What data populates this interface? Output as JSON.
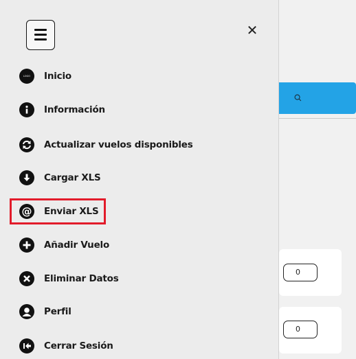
{
  "drawer": {
    "close_symbol": "✕",
    "menu_icon": "hamburger-menu-icon",
    "items": [
      {
        "label": "Inicio",
        "icon": "logo-icon",
        "icon_text": "LOGO"
      },
      {
        "label": "Información",
        "icon": "info-icon"
      },
      {
        "label": "Actualizar vuelos disponibles",
        "icon": "refresh-icon"
      },
      {
        "label": "Cargar XLS",
        "icon": "download-icon"
      },
      {
        "label": "Enviar XLS",
        "icon": "at-icon",
        "highlighted": true
      },
      {
        "label": "Añadir Vuelo",
        "icon": "plus-icon"
      },
      {
        "label": "Eliminar Datos",
        "icon": "x-circle-icon"
      },
      {
        "label": "Perfil",
        "icon": "user-icon"
      },
      {
        "label": "Cerrar Sesión",
        "icon": "logout-icon"
      }
    ]
  },
  "background": {
    "search_icon": "search-icon",
    "counters": [
      "0",
      "0"
    ]
  },
  "colors": {
    "accent": "#23a3e6",
    "highlight": "#e21b2a",
    "drawer_bg": "#ececec"
  }
}
